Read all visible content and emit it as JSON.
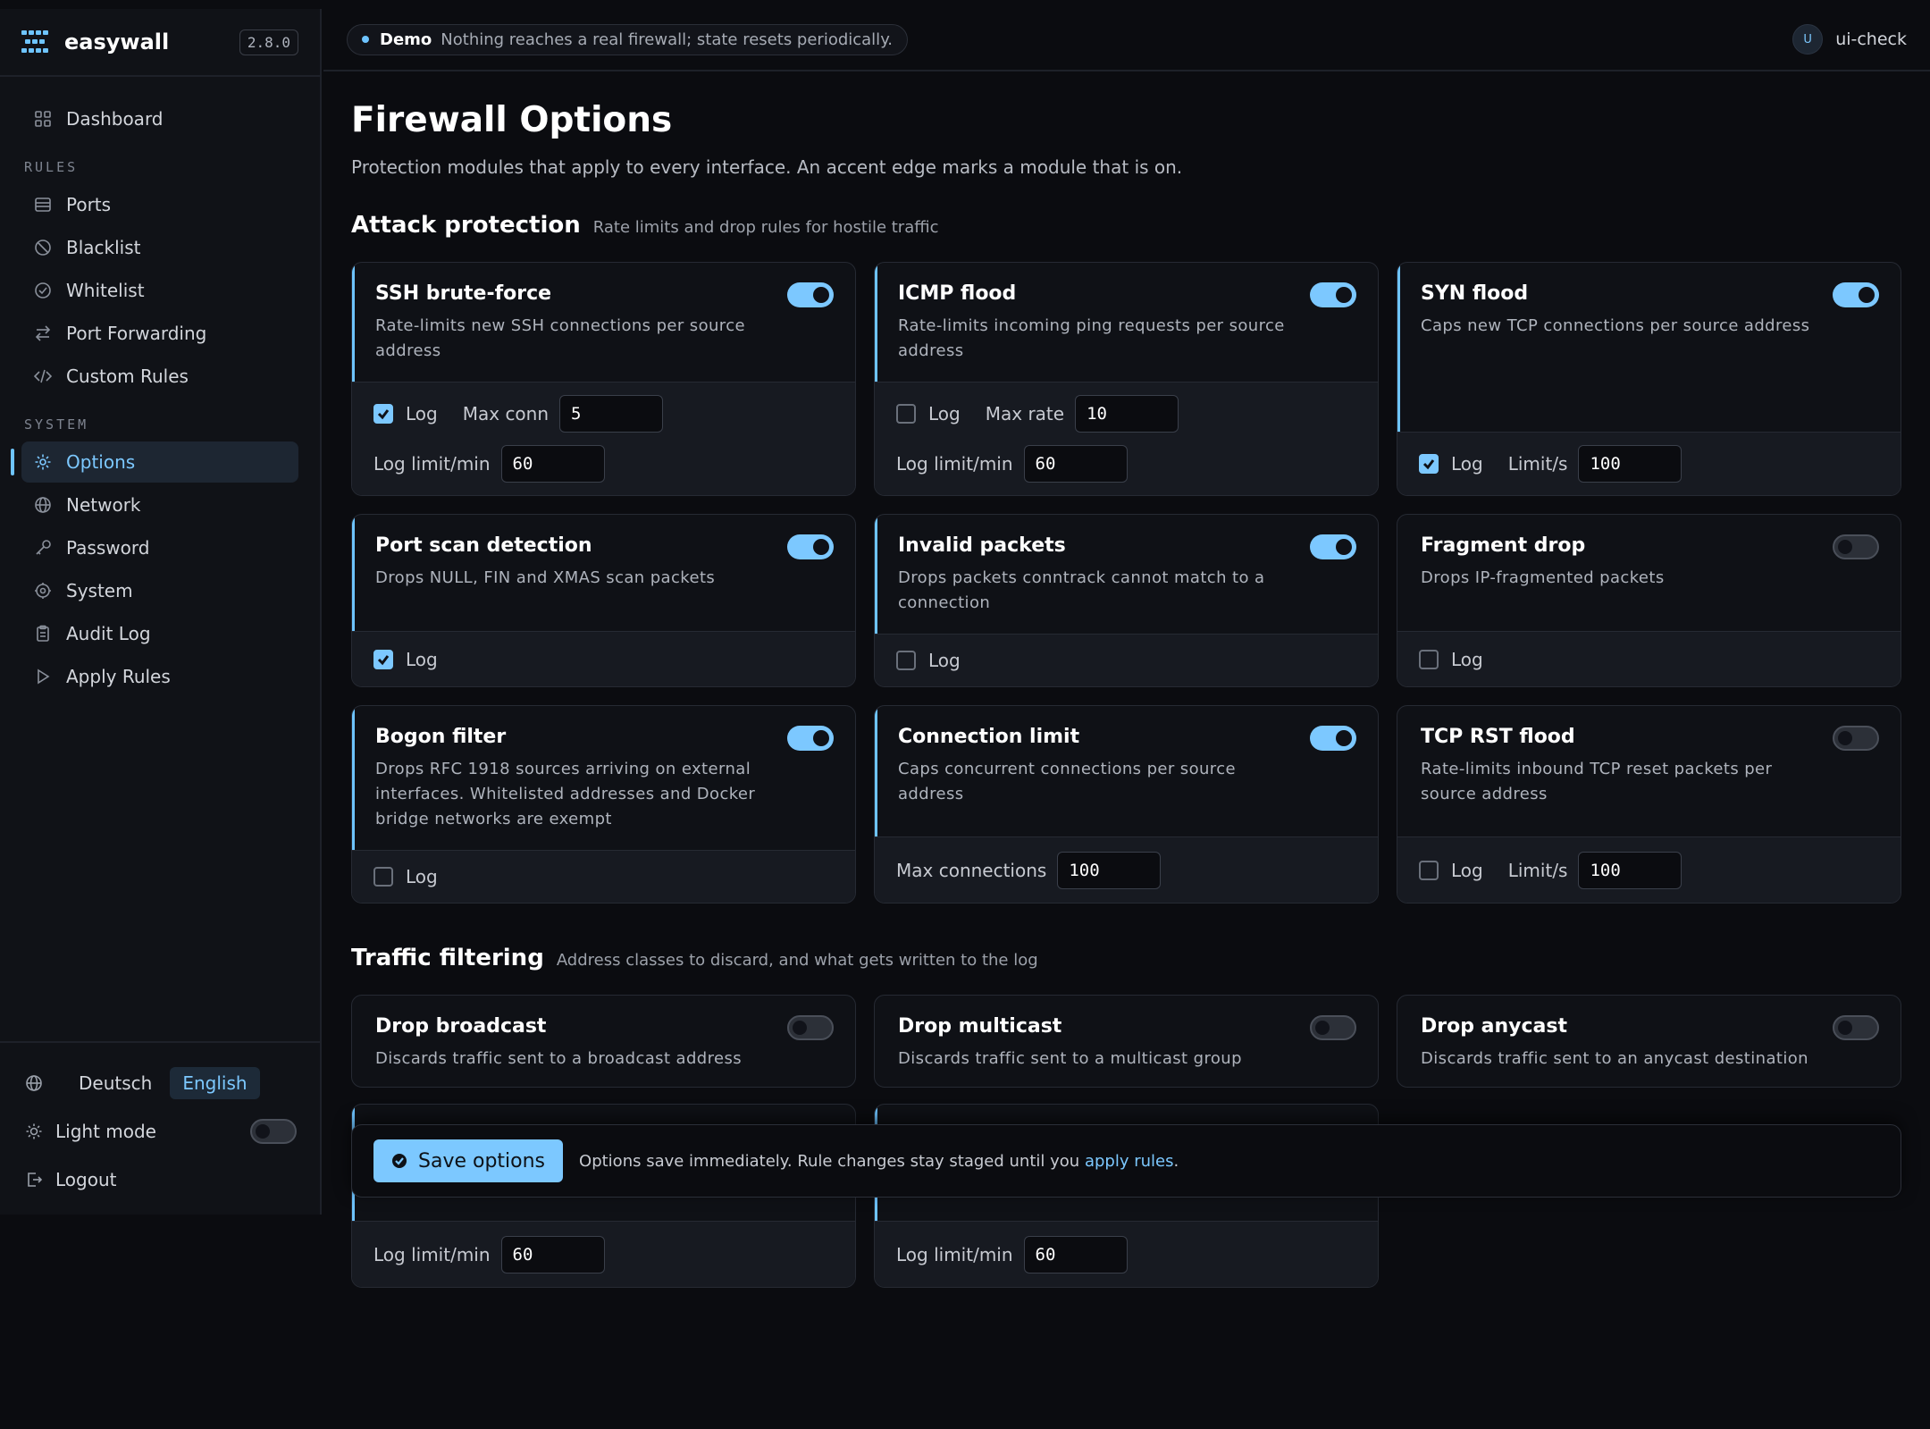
{
  "app": {
    "name": "easywall",
    "version": "2.8.0"
  },
  "nav": {
    "dashboard": "Dashboard",
    "rules_section": "RULES",
    "rules": [
      {
        "label": "Ports",
        "icon": "ports-icon"
      },
      {
        "label": "Blacklist",
        "icon": "blacklist-icon"
      },
      {
        "label": "Whitelist",
        "icon": "whitelist-icon"
      },
      {
        "label": "Port Forwarding",
        "icon": "port-forwarding-icon"
      },
      {
        "label": "Custom Rules",
        "icon": "code-icon"
      }
    ],
    "system_section": "SYSTEM",
    "system": [
      {
        "label": "Options",
        "icon": "gear-icon",
        "active": true
      },
      {
        "label": "Network",
        "icon": "globe-icon"
      },
      {
        "label": "Password",
        "icon": "key-icon"
      },
      {
        "label": "System",
        "icon": "cog-icon"
      },
      {
        "label": "Audit Log",
        "icon": "clipboard-icon"
      },
      {
        "label": "Apply Rules",
        "icon": "play-icon"
      }
    ]
  },
  "footer": {
    "lang_de": "Deutsch",
    "lang_en": "English",
    "light_mode": "Light mode",
    "logout": "Logout"
  },
  "topbar": {
    "demo_label": "Demo",
    "demo_text": "Nothing reaches a real firewall; state resets periodically.",
    "user_initial": "U",
    "user": "ui-check"
  },
  "page": {
    "title": "Firewall Options",
    "subtitle": "Protection modules that apply to every interface. An accent edge marks a module that is on."
  },
  "attack": {
    "title": "Attack protection",
    "subtitle": "Rate limits and drop rules for hostile traffic",
    "ssh": {
      "name": "SSH brute-force",
      "desc": "Rate-limits new SSH connections per source address",
      "enabled": true,
      "log": true,
      "log_label": "Log",
      "max_conn_label": "Max conn",
      "max_conn": "5",
      "log_limit_label": "Log limit/min",
      "log_limit": "60"
    },
    "icmp": {
      "name": "ICMP flood",
      "desc": "Rate-limits incoming ping requests per source address",
      "enabled": true,
      "log": false,
      "log_label": "Log",
      "max_rate_label": "Max rate",
      "max_rate": "10",
      "log_limit_label": "Log limit/min",
      "log_limit": "60"
    },
    "syn": {
      "name": "SYN flood",
      "desc": "Caps new TCP connections per source address",
      "enabled": true,
      "log": true,
      "log_label": "Log",
      "limit_label": "Limit/s",
      "limit": "100"
    },
    "portscan": {
      "name": "Port scan detection",
      "desc": "Drops NULL, FIN and XMAS scan packets",
      "enabled": true,
      "log": true,
      "log_label": "Log"
    },
    "invalid": {
      "name": "Invalid packets",
      "desc": "Drops packets conntrack cannot match to a connection",
      "enabled": true,
      "log": false,
      "log_label": "Log"
    },
    "fragment": {
      "name": "Fragment drop",
      "desc": "Drops IP-fragmented packets",
      "enabled": false,
      "log": false,
      "log_label": "Log"
    },
    "bogon": {
      "name": "Bogon filter",
      "desc": "Drops RFC 1918 sources arriving on external interfaces. Whitelisted addresses and Docker bridge networks are exempt",
      "enabled": true,
      "log": false,
      "log_label": "Log"
    },
    "connlimit": {
      "name": "Connection limit",
      "desc": "Caps concurrent connections per source address",
      "enabled": true,
      "max_conn_label": "Max connections",
      "max_conn": "100"
    },
    "rst": {
      "name": "TCP RST flood",
      "desc": "Rate-limits inbound TCP reset packets per source address",
      "enabled": false,
      "log": false,
      "log_label": "Log",
      "limit_label": "Limit/s",
      "limit": "100"
    }
  },
  "traffic": {
    "title": "Traffic filtering",
    "subtitle": "Address classes to discard, and what gets written to the log",
    "broadcast": {
      "name": "Drop broadcast",
      "desc": "Discards traffic sent to a broadcast address",
      "enabled": false
    },
    "multicast": {
      "name": "Drop multicast",
      "desc": "Discards traffic sent to a multicast group",
      "enabled": false
    },
    "anycast": {
      "name": "Drop anycast",
      "desc": "Discards traffic sent to an anycast destination",
      "enabled": false
    },
    "log_a": {
      "enabled": true,
      "log_limit_label": "Log limit/min",
      "log_limit": "60"
    },
    "log_b": {
      "enabled": true,
      "log_limit_label": "Log limit/min",
      "log_limit": "60"
    }
  },
  "savebar": {
    "button": "Save options",
    "note": "Options save immediately. Rule changes stay staged until you",
    "link": "apply rules",
    "end": "."
  },
  "colors": {
    "accent": "#7cc8ff",
    "background": "#0b0c10",
    "card": "#0f1116"
  }
}
